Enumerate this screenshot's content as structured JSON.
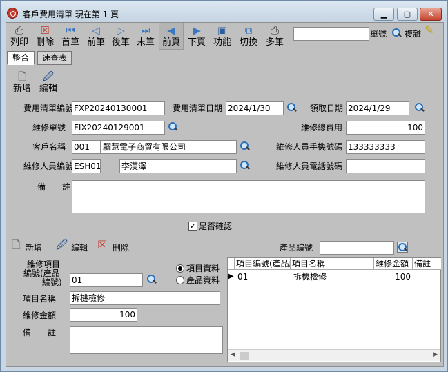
{
  "window": {
    "title": "客戶費用清單 現在第 1 頁",
    "min_label": "▁",
    "max_label": "▢",
    "close_label": "✕"
  },
  "toolbar": {
    "buttons": [
      {
        "label": "列印",
        "icon": "printer-icon"
      },
      {
        "label": "刪除",
        "icon": "delete-icon"
      },
      {
        "label": "首筆",
        "icon": "first-record-icon"
      },
      {
        "label": "前筆",
        "icon": "prev-record-icon"
      },
      {
        "label": "後筆",
        "icon": "next-record-icon"
      },
      {
        "label": "末筆",
        "icon": "last-record-icon"
      },
      {
        "label": "前頁",
        "icon": "prev-page-icon"
      },
      {
        "label": "下頁",
        "icon": "next-page-icon"
      },
      {
        "label": "功能",
        "icon": "function-icon"
      },
      {
        "label": "切換",
        "icon": "switch-icon"
      },
      {
        "label": "多筆",
        "icon": "multi-record-icon"
      }
    ],
    "search_value": "",
    "doc_no_label": "單號",
    "complex_label": "複雜"
  },
  "tabs": [
    "整合",
    "速查表"
  ],
  "actions": {
    "new_label": "新增",
    "edit_label": "編輯"
  },
  "form": {
    "expense_no_label": "費用清單編號",
    "expense_no": "FXP20240130001",
    "expense_date_label": "費用清單日期",
    "expense_date": "2024/1/30",
    "receive_date_label": "領取日期",
    "receive_date": "2024/1/29",
    "repair_no_label": "維修單號",
    "repair_no": "FIX20240129001",
    "repair_total_label": "維修總費用",
    "repair_total": "100",
    "customer_label": "客戶名稱",
    "customer_code": "001",
    "customer_name": "驪慧電子商貿有限公司",
    "mobile_label": "維修人員手機號碼",
    "mobile": "133333333",
    "staff_label": "維修人員編號",
    "staff_code": "ESH01",
    "staff_name": "李漢澤",
    "phone_label": "維修人員電話號碼",
    "phone": "",
    "remark_label": "備　　註",
    "remark": "",
    "confirm_label": "是否確認",
    "confirm_checked": "✓"
  },
  "detail": {
    "new_label": "新增",
    "edit_label": "編輯",
    "delete_label": "刪除",
    "product_no_label": "產品編號",
    "product_no": "",
    "item_no_label_1": "維修項目",
    "item_no_label_2": "編號(產品",
    "item_no_label_3": "編號)",
    "item_no": "01",
    "radio_item_label": "項目資料",
    "radio_product_label": "產品資料",
    "item_name_label": "項目名稱",
    "item_name": "拆機檢修",
    "amount_label": "維修金額",
    "amount": "100",
    "remark_label": "備　　註",
    "remark": ""
  },
  "grid": {
    "columns": [
      "項目編號(產品編號)",
      "項目名稱",
      "維修金額",
      "備註"
    ],
    "rows": [
      {
        "indicator": "▶",
        "no": "01",
        "name": "拆機檢修",
        "amount": "100",
        "remark": ""
      }
    ],
    "scroll_left": "◀",
    "scroll_right": "▶"
  }
}
